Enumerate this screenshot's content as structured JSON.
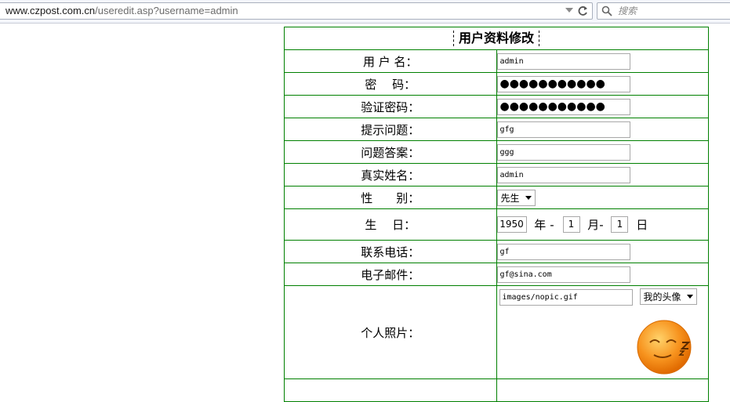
{
  "browser": {
    "url_host": "www.czpost.com.cn",
    "url_path": "/useredit.asp?username=admin",
    "search_placeholder": "搜索"
  },
  "form": {
    "title": "用户资料修改",
    "username": {
      "label": "用 户 名：",
      "value": "admin"
    },
    "password": {
      "label": "密　 码：",
      "value": "●●●●●●●●●●●"
    },
    "confirm_password": {
      "label": "验证密码：",
      "value": "●●●●●●●●●●●"
    },
    "question": {
      "label": "提示问题：",
      "value": "gfg"
    },
    "answer": {
      "label": "问题答案：",
      "value": "ggg"
    },
    "realname": {
      "label": "真实姓名：",
      "value": "admin"
    },
    "gender": {
      "label": "性　　别：",
      "value": "先生"
    },
    "birthday": {
      "label": "生　 日：",
      "year": "1950",
      "year_unit": "年",
      "month": "1",
      "month_unit": "月-",
      "day": "1",
      "day_unit": "日"
    },
    "phone": {
      "label": "联系电话：",
      "value": "gf"
    },
    "email": {
      "label": "电子邮件：",
      "value": "gf@sina.com"
    },
    "photo": {
      "label": "个人照片：",
      "path": "images/nopic.gif",
      "select_value": "我的头像"
    }
  },
  "colors": {
    "table_border": "#008000",
    "avatar": "#f7931e"
  }
}
